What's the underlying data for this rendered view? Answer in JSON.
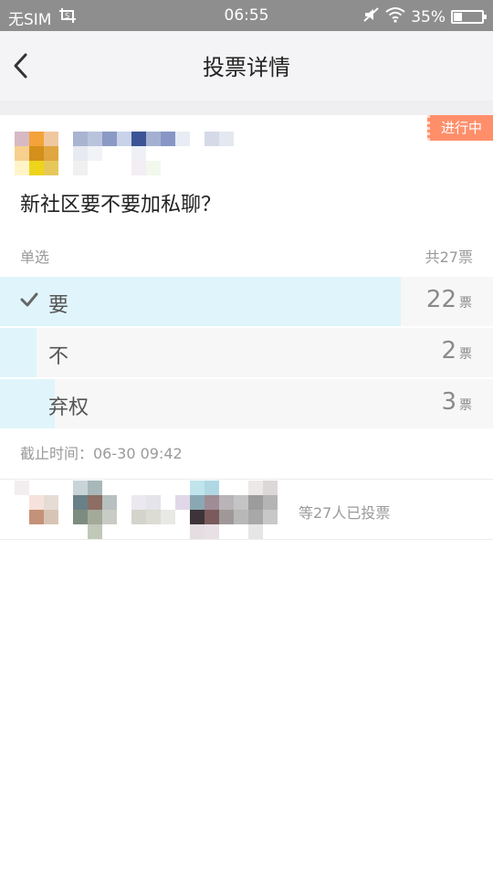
{
  "status_bar": {
    "carrier": "无SIM",
    "time": "06:55",
    "battery": "35%",
    "battery_level": 0.35,
    "icons": [
      "screenshot-icon",
      "wifi-icon",
      "mute-icon",
      "battery-icon"
    ]
  },
  "nav": {
    "title": "投票详情",
    "back_icon": "chevron-left-icon"
  },
  "poll": {
    "status_badge": "进行中",
    "question": "新社区要不要加私聊？",
    "type": "单选",
    "total": "共27票",
    "options": [
      {
        "label": "要",
        "count": "22",
        "unit": "票",
        "fraction": 0.815,
        "checked": true
      },
      {
        "label": "不",
        "count": "2",
        "unit": "票",
        "fraction": 0.074,
        "checked": false
      },
      {
        "label": "弃权",
        "count": "3",
        "unit": "票",
        "fraction": 0.111,
        "checked": false
      }
    ],
    "deadline": "截止时间：06-30 09:42",
    "voters_text": "等27人已投票"
  },
  "colors": {
    "accent_badge": "#ff8f6b",
    "vote_bar": "#e0f5fb",
    "status_bar": "#8e8e8e"
  }
}
